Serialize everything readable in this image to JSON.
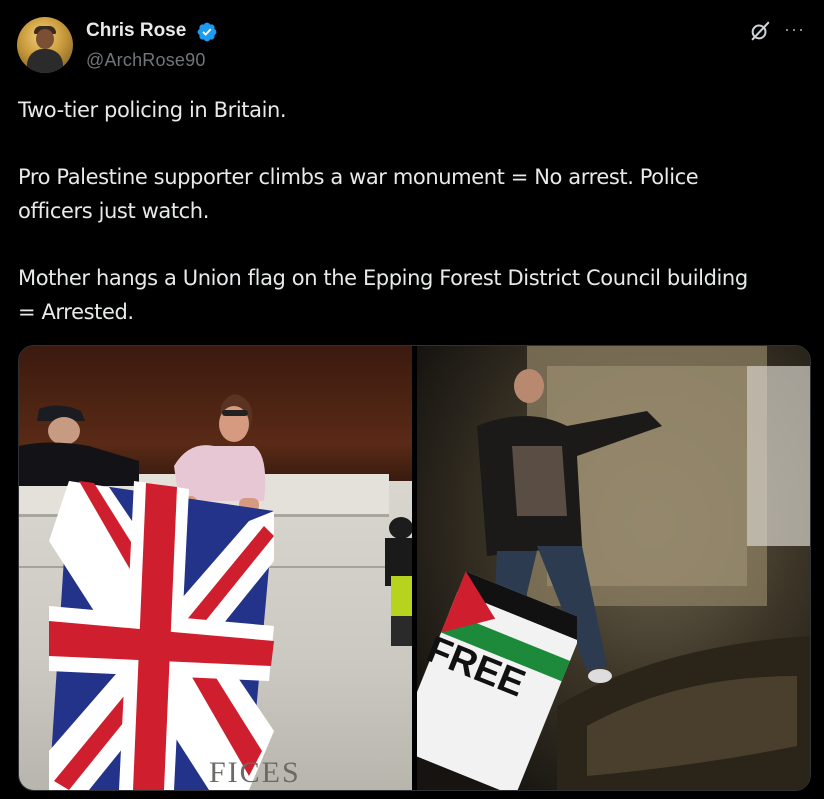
{
  "author": {
    "name": "Chris Rose",
    "handle": "@ArchRose90",
    "verified": true,
    "avatar_icon": "avatar-photo"
  },
  "icons": {
    "verified": "verified-badge-icon",
    "grok": "grok-icon",
    "more": "more-options-icon"
  },
  "more_glyph": "···",
  "tweet": {
    "line1": "Two-tier policing in Britain.",
    "line2a": "Pro Palestine supporter climbs a war monument = No arrest. Police",
    "line2b": "officers just watch.",
    "line3a": "Mother hangs a Union flag on the Epping Forest District Council building",
    "line3b": "= Arrested."
  },
  "media": {
    "left_sign_text": "FICES",
    "right_placard_text": "FREE"
  },
  "colors": {
    "background": "#000000",
    "text": "#e7e9ea",
    "secondary": "#71767b",
    "verified": "#1d9bf0"
  }
}
